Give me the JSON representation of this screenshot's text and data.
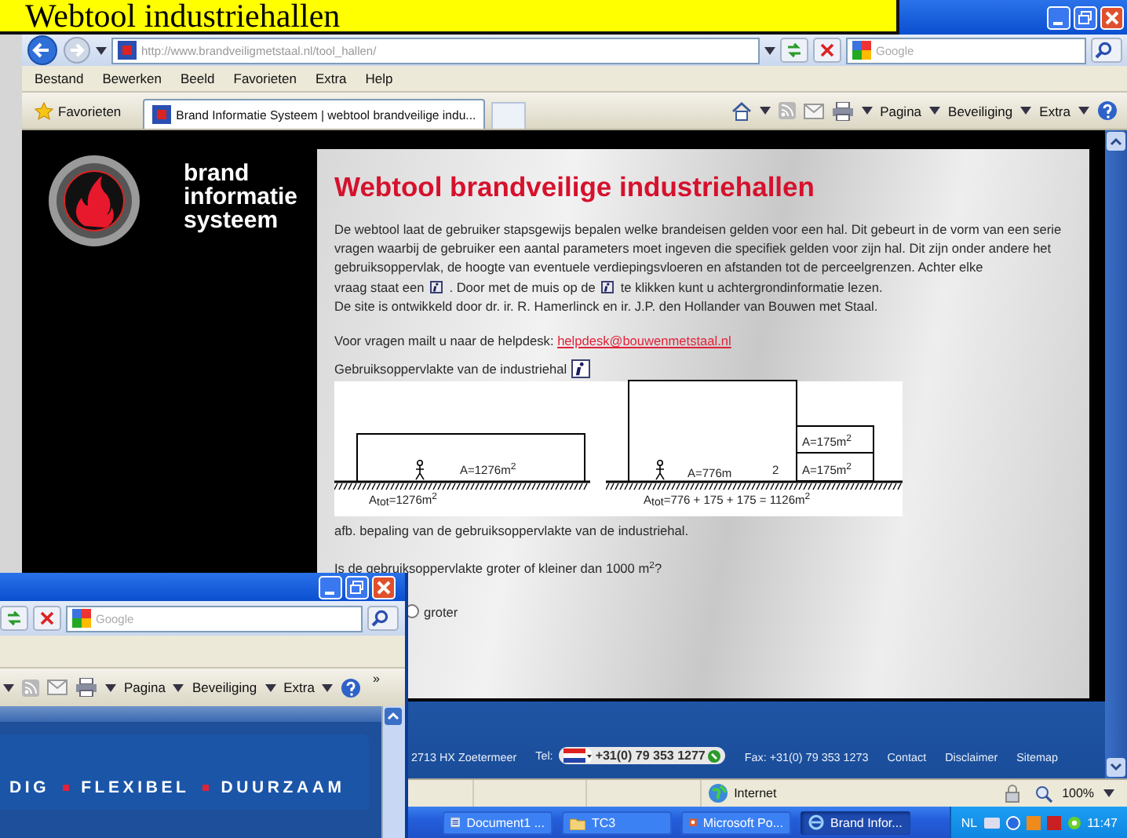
{
  "banner": {
    "title": "Webtool industriehallen"
  },
  "browser": {
    "address": "http://www.brandveiligmetstaal.nl/tool_hallen/",
    "search_placeholder": "Google",
    "menu": [
      "Bestand",
      "Bewerken",
      "Beeld",
      "Favorieten",
      "Extra",
      "Help"
    ],
    "favorites": "Favorieten",
    "tabs": [
      {
        "label": "Brand Informatie Systeem | webtool brandveilige indu...",
        "selected": true
      }
    ],
    "commands": [
      "Pagina",
      "Beveiliging",
      "Extra"
    ],
    "status": {
      "zone": "Internet",
      "zoom": "100%"
    }
  },
  "site": {
    "logo_lines": [
      "brand",
      "informatie",
      "systeem"
    ],
    "heading": "Webtool brandveilige industriehallen",
    "intro": [
      "De webtool laat de gebruiker stapsgewijs bepalen welke brandeisen gelden voor een hal. Dit gebeurt in de vorm van een serie vragen waarbij de gebruiker een aantal parameters moet ingeven die specifiek gelden voor zijn hal. Dit zijn onder andere het gebruiksoppervlak, de hoogte van eventuele verdiepingsvloeren en afstanden tot de perceelgrenzen. Achter elke",
      "vraag staat een",
      ". Door met de muis op de",
      "te klikken kunt u achtergrondinformatie lezen."
    ],
    "credit": "De site is ontwikkeld door dr. ir. R. Hamerlinck en ir. J.P. den Hollander van Bouwen met Staal.",
    "helpdesk_text": "Voor vragen mailt u naar de helpdesk:",
    "helpdesk_link": "helpdesk@bouwenmetstaal.nl",
    "field_label": "Gebruiksoppervlakte van de industriehal",
    "diagram_labels": [
      "A=1276m$^{2}$",
      "A$_{tot}$=1276m$^{2}$",
      "A=776m",
      "2",
      "A=175m$^{2}$",
      "A=175m$^{2}$",
      "A$_{tot}$=776 + 175 + 175 = 1126m$^{2}$"
    ],
    "caption": "afb. bepaling van de gebruiksoppervlakte van de industriehal.",
    "question": "Is de gebruiksoppervlakte groter of kleiner dan 1000 m$^{2}$?",
    "options": [
      {
        "label": "groter",
        "selected": false
      }
    ],
    "footer": {
      "address": "2713 HX  Zoetermeer",
      "tel_label": "Tel:",
      "phone": "+31(0) 79 353 1277",
      "fax": "Fax: +31(0) 79 353 1273",
      "links": [
        "Contact",
        "Disclaimer",
        "Sitemap"
      ]
    }
  },
  "taskbar": {
    "items": [
      {
        "label": "Document1 ...",
        "selected": false
      },
      {
        "label": "TC3",
        "selected": false
      },
      {
        "label": "Microsoft Po...",
        "selected": false
      },
      {
        "label": "Brand Infor...",
        "selected": true
      }
    ],
    "language": "NL",
    "clock": "11:47"
  },
  "second_window": {
    "search_placeholder": "Google",
    "commands": [
      "Pagina",
      "Beveiliging",
      "Extra"
    ],
    "more": "»",
    "slogan": [
      "DIG",
      "FLEXIBEL",
      "DUURZAAM"
    ]
  }
}
